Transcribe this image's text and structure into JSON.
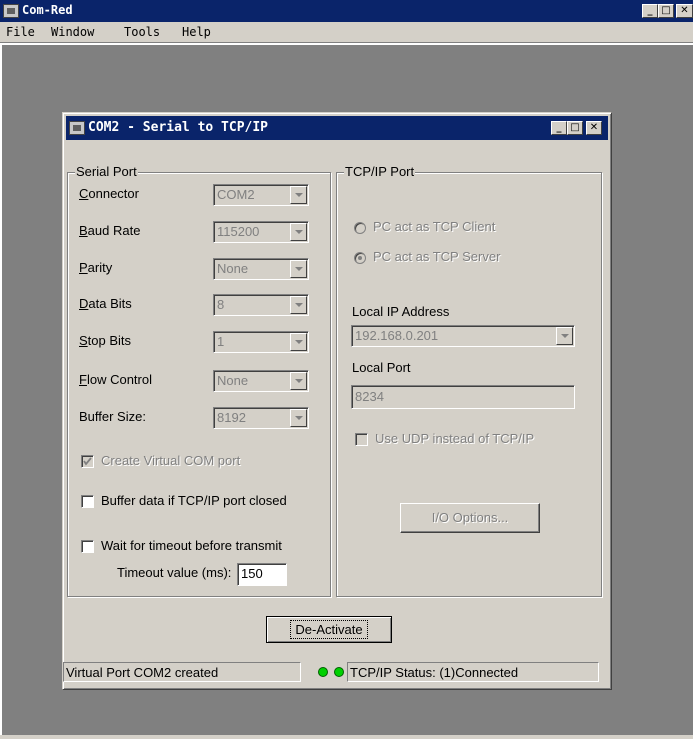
{
  "app": {
    "title": "Com-Red",
    "menu": [
      "File",
      "Window",
      "Tools",
      "Help"
    ]
  },
  "child": {
    "title": "COM2 - Serial to TCP/IP",
    "serial": {
      "legend": "Serial Port",
      "fields": [
        {
          "label": "Connector",
          "value": "COM2"
        },
        {
          "label": "Baud Rate",
          "value": "115200"
        },
        {
          "label": "Parity",
          "value": "None"
        },
        {
          "label": "Data Bits",
          "value": "8"
        },
        {
          "label": "Stop Bits",
          "value": "1"
        },
        {
          "label": "Flow Control",
          "value": "None"
        },
        {
          "label": "Buffer Size:",
          "value": "8192"
        }
      ],
      "create_virtual": "Create Virtual COM port",
      "buffer_data": "Buffer data if TCP/IP port closed",
      "wait_timeout": "Wait for timeout before transmit",
      "timeout_label": "Timeout value (ms):",
      "timeout_value": "150"
    },
    "tcp": {
      "legend": "TCP/IP Port",
      "client_option": "PC act as TCP Client",
      "server_option": "PC act as TCP Server",
      "ip_label": "Local IP Address",
      "ip_value": "192.168.0.201",
      "port_label": "Local Port",
      "port_value": "8234",
      "udp_option": "Use UDP instead of TCP/IP",
      "io_options": "I/O Options..."
    },
    "deactivate": "De-Activate",
    "status_left": "Virtual Port COM2 created",
    "status_right": "TCP/IP Status: (1)Connected"
  },
  "colors": {
    "titlebar": "#0a246a",
    "face": "#d4d0c8",
    "led": "#00d000"
  }
}
